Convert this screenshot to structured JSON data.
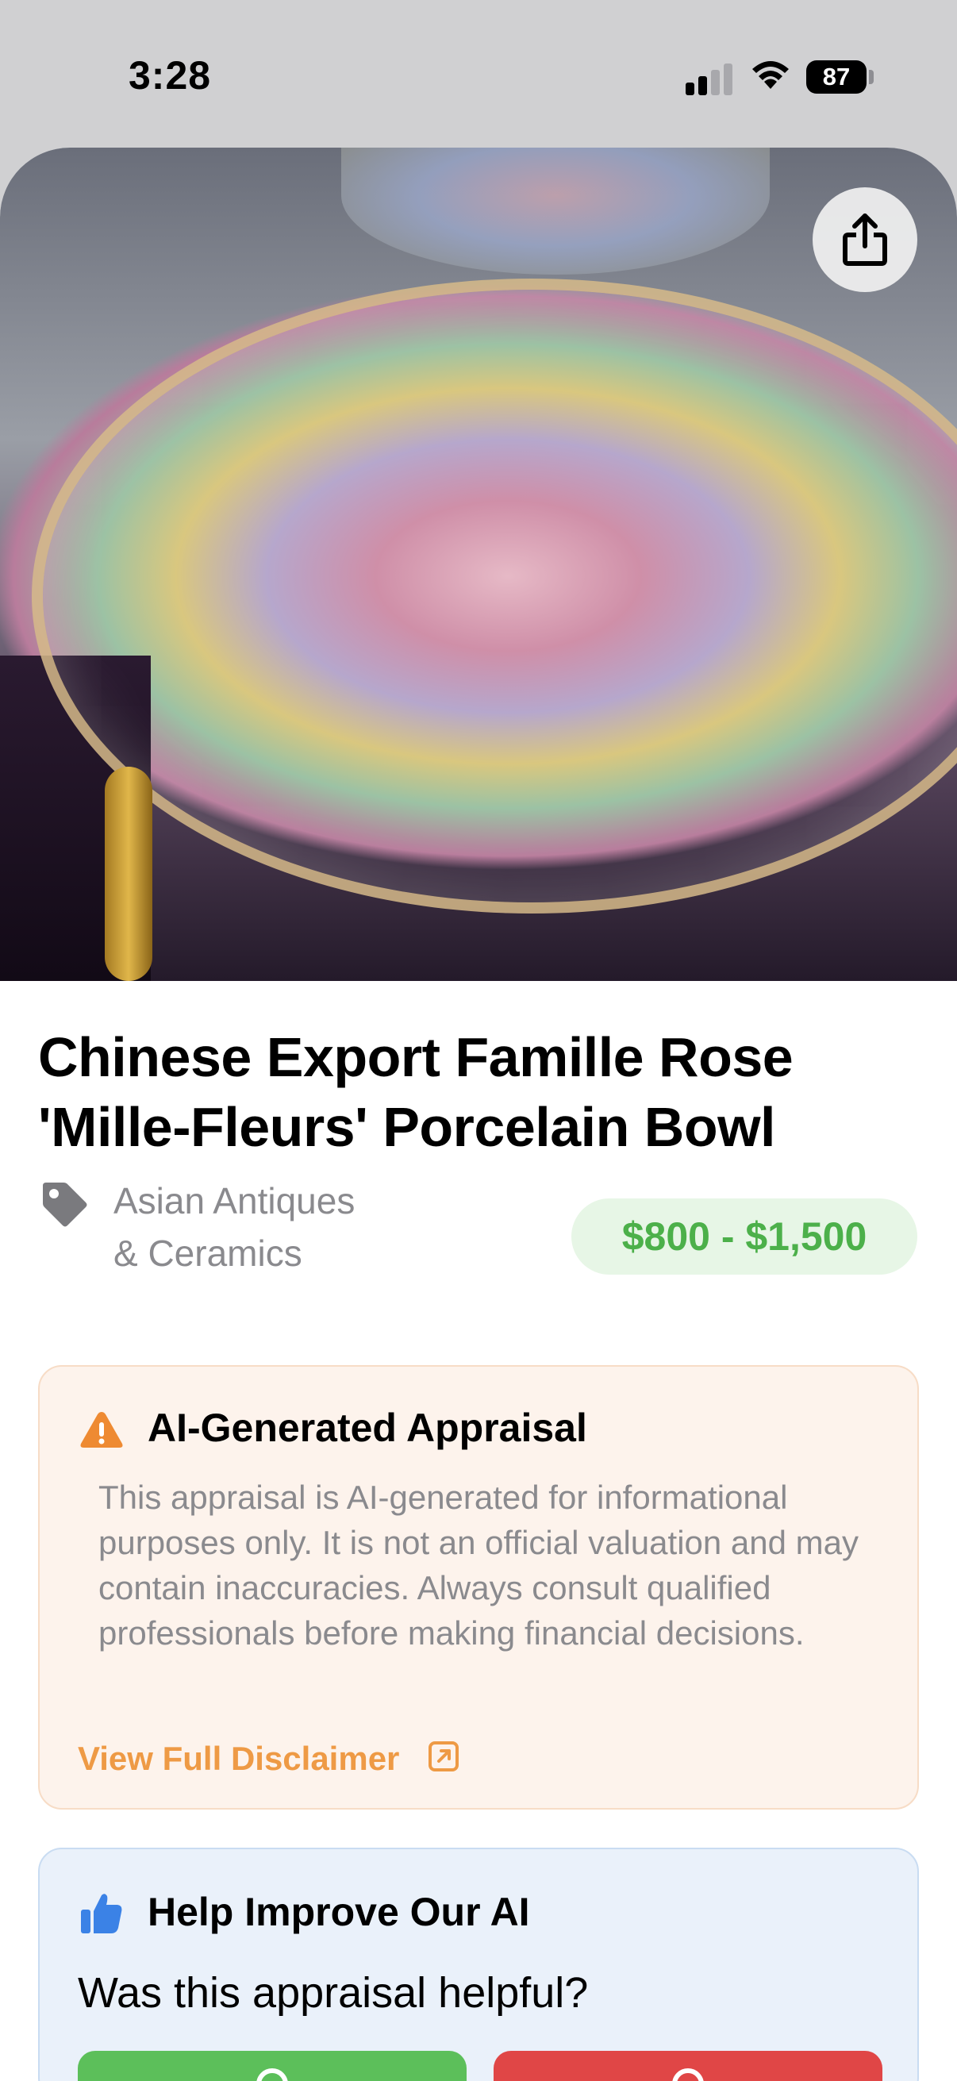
{
  "status_bar": {
    "time": "3:28",
    "battery": "87",
    "icons": [
      "signal-icon",
      "wifi-icon",
      "battery-icon"
    ]
  },
  "hero": {
    "share_icon": "share-icon"
  },
  "item": {
    "title": "Chinese Export Famille Rose 'Mille-Fleurs' Porcelain Bowl",
    "category_line1": "Asian Antiques",
    "category_line2": "& Ceramics",
    "category_icon": "tag-icon",
    "price_range": "$800 - $1,500"
  },
  "disclaimer": {
    "icon": "warning-icon",
    "heading": "AI-Generated Appraisal",
    "body": "This appraisal is AI-generated for informational purposes only. It is not an official valuation and may contain inaccuracies. Always consult qualified professionals before making financial decisions.",
    "link_label": "View Full Disclaimer",
    "link_icon": "external-link-icon"
  },
  "feedback": {
    "icon": "thumbs-up-icon",
    "heading": "Help Improve Our AI",
    "question": "Was this appraisal helpful?"
  },
  "colors": {
    "price_green": "#4cb04a",
    "price_bg": "#e7f6e6",
    "warning_orange": "#ee9a45",
    "disclaimer_bg": "#fdf3ec",
    "feedback_bg": "#eaf1fa",
    "yes_green": "#5cbf5a",
    "no_red": "#e04646"
  }
}
